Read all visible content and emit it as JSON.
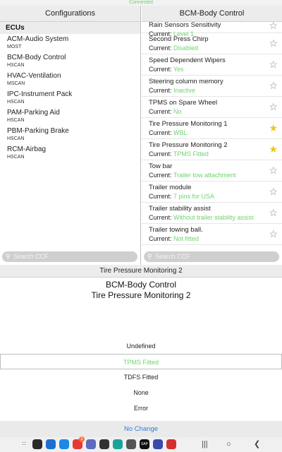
{
  "status_text": "Connected",
  "left_pane": {
    "header": "Configurations",
    "section_label": "ECUs",
    "items": [
      {
        "name": "ACM-Audio System",
        "bus": "MOST"
      },
      {
        "name": "BCM-Body Control",
        "bus": "HSCAN"
      },
      {
        "name": "HVAC-Ventilation",
        "bus": "MSCAN"
      },
      {
        "name": "IPC-Instrument Pack",
        "bus": "HSCAN"
      },
      {
        "name": "PAM-Parking Aid",
        "bus": "HSCAN"
      },
      {
        "name": "PBM-Parking Brake",
        "bus": "HSCAN"
      },
      {
        "name": "RCM-Airbag",
        "bus": "HSCAN"
      }
    ],
    "search_placeholder": "Search CCF"
  },
  "right_pane": {
    "header": "BCM-Body Control",
    "current_prefix": "Current: ",
    "items": [
      {
        "name": "Rain Sensors Sensitivity",
        "current": "Level 1",
        "favorite": false
      },
      {
        "name": "Second Press Chirp",
        "current": "Disabled",
        "favorite": false
      },
      {
        "name": "Speed Dependent Wipers",
        "current": "Yes",
        "favorite": false
      },
      {
        "name": "Steering column memory",
        "current": "Inactive",
        "favorite": false
      },
      {
        "name": "TPMS on Spare Wheel",
        "current": "No",
        "favorite": false
      },
      {
        "name": "Tire Pressure Monitoring 1",
        "current": "WBL",
        "favorite": true
      },
      {
        "name": "Tire Pressure Monitoring 2",
        "current": "TPMS Fitted",
        "favorite": true
      },
      {
        "name": "Tow bar",
        "current": "Trailer tow attachment",
        "favorite": false
      },
      {
        "name": "Trailer module",
        "current": "7 pins for USA",
        "favorite": false
      },
      {
        "name": "Trailer stability assist",
        "current": "Without trailer stability assist",
        "favorite": false
      },
      {
        "name": "Trailer towing ball.",
        "current": "Not fitted",
        "favorite": false
      }
    ],
    "search_placeholder": "Search CCF"
  },
  "dialog": {
    "header": "Tire Pressure Monitoring 2",
    "title_line1": "BCM-Body Control",
    "title_line2": "Tire Pressure Monitoring 2",
    "options": [
      "Undefined",
      "TPMS Fitted",
      "TDFS Fitted",
      "None",
      "Error"
    ],
    "selected_option": "TPMS Fitted",
    "no_change_label": "No Change"
  },
  "taskbar": {
    "apps": [
      {
        "icon": "app-grid-icon",
        "color": "#444444"
      },
      {
        "icon": "camera-app-icon",
        "color": "#2a2a2a"
      },
      {
        "icon": "contacts-app-icon",
        "color": "#1c6fd1"
      },
      {
        "icon": "chat-app-icon",
        "color": "#1e88e5"
      },
      {
        "icon": "email-app-icon",
        "color": "#e53935"
      },
      {
        "icon": "notes-app-icon",
        "color": "#5c6bc0"
      },
      {
        "icon": "camera-dot-icon",
        "color": "#333333"
      },
      {
        "icon": "edge-browser-icon",
        "color": "#1aa39a"
      },
      {
        "icon": "settings-app-icon",
        "color": "#555555"
      },
      {
        "icon": "sap-app-icon",
        "color": "#111111"
      },
      {
        "icon": "multi-app-icon",
        "color": "#3949ab"
      },
      {
        "icon": "pdf-app-icon",
        "color": "#d32f2f"
      }
    ],
    "sap_label": "SAP",
    "badge_count": "1"
  },
  "colors": {
    "accent_green": "#6cd46c",
    "link_blue": "#2e7be0",
    "star_favorite": "#f0c419"
  }
}
